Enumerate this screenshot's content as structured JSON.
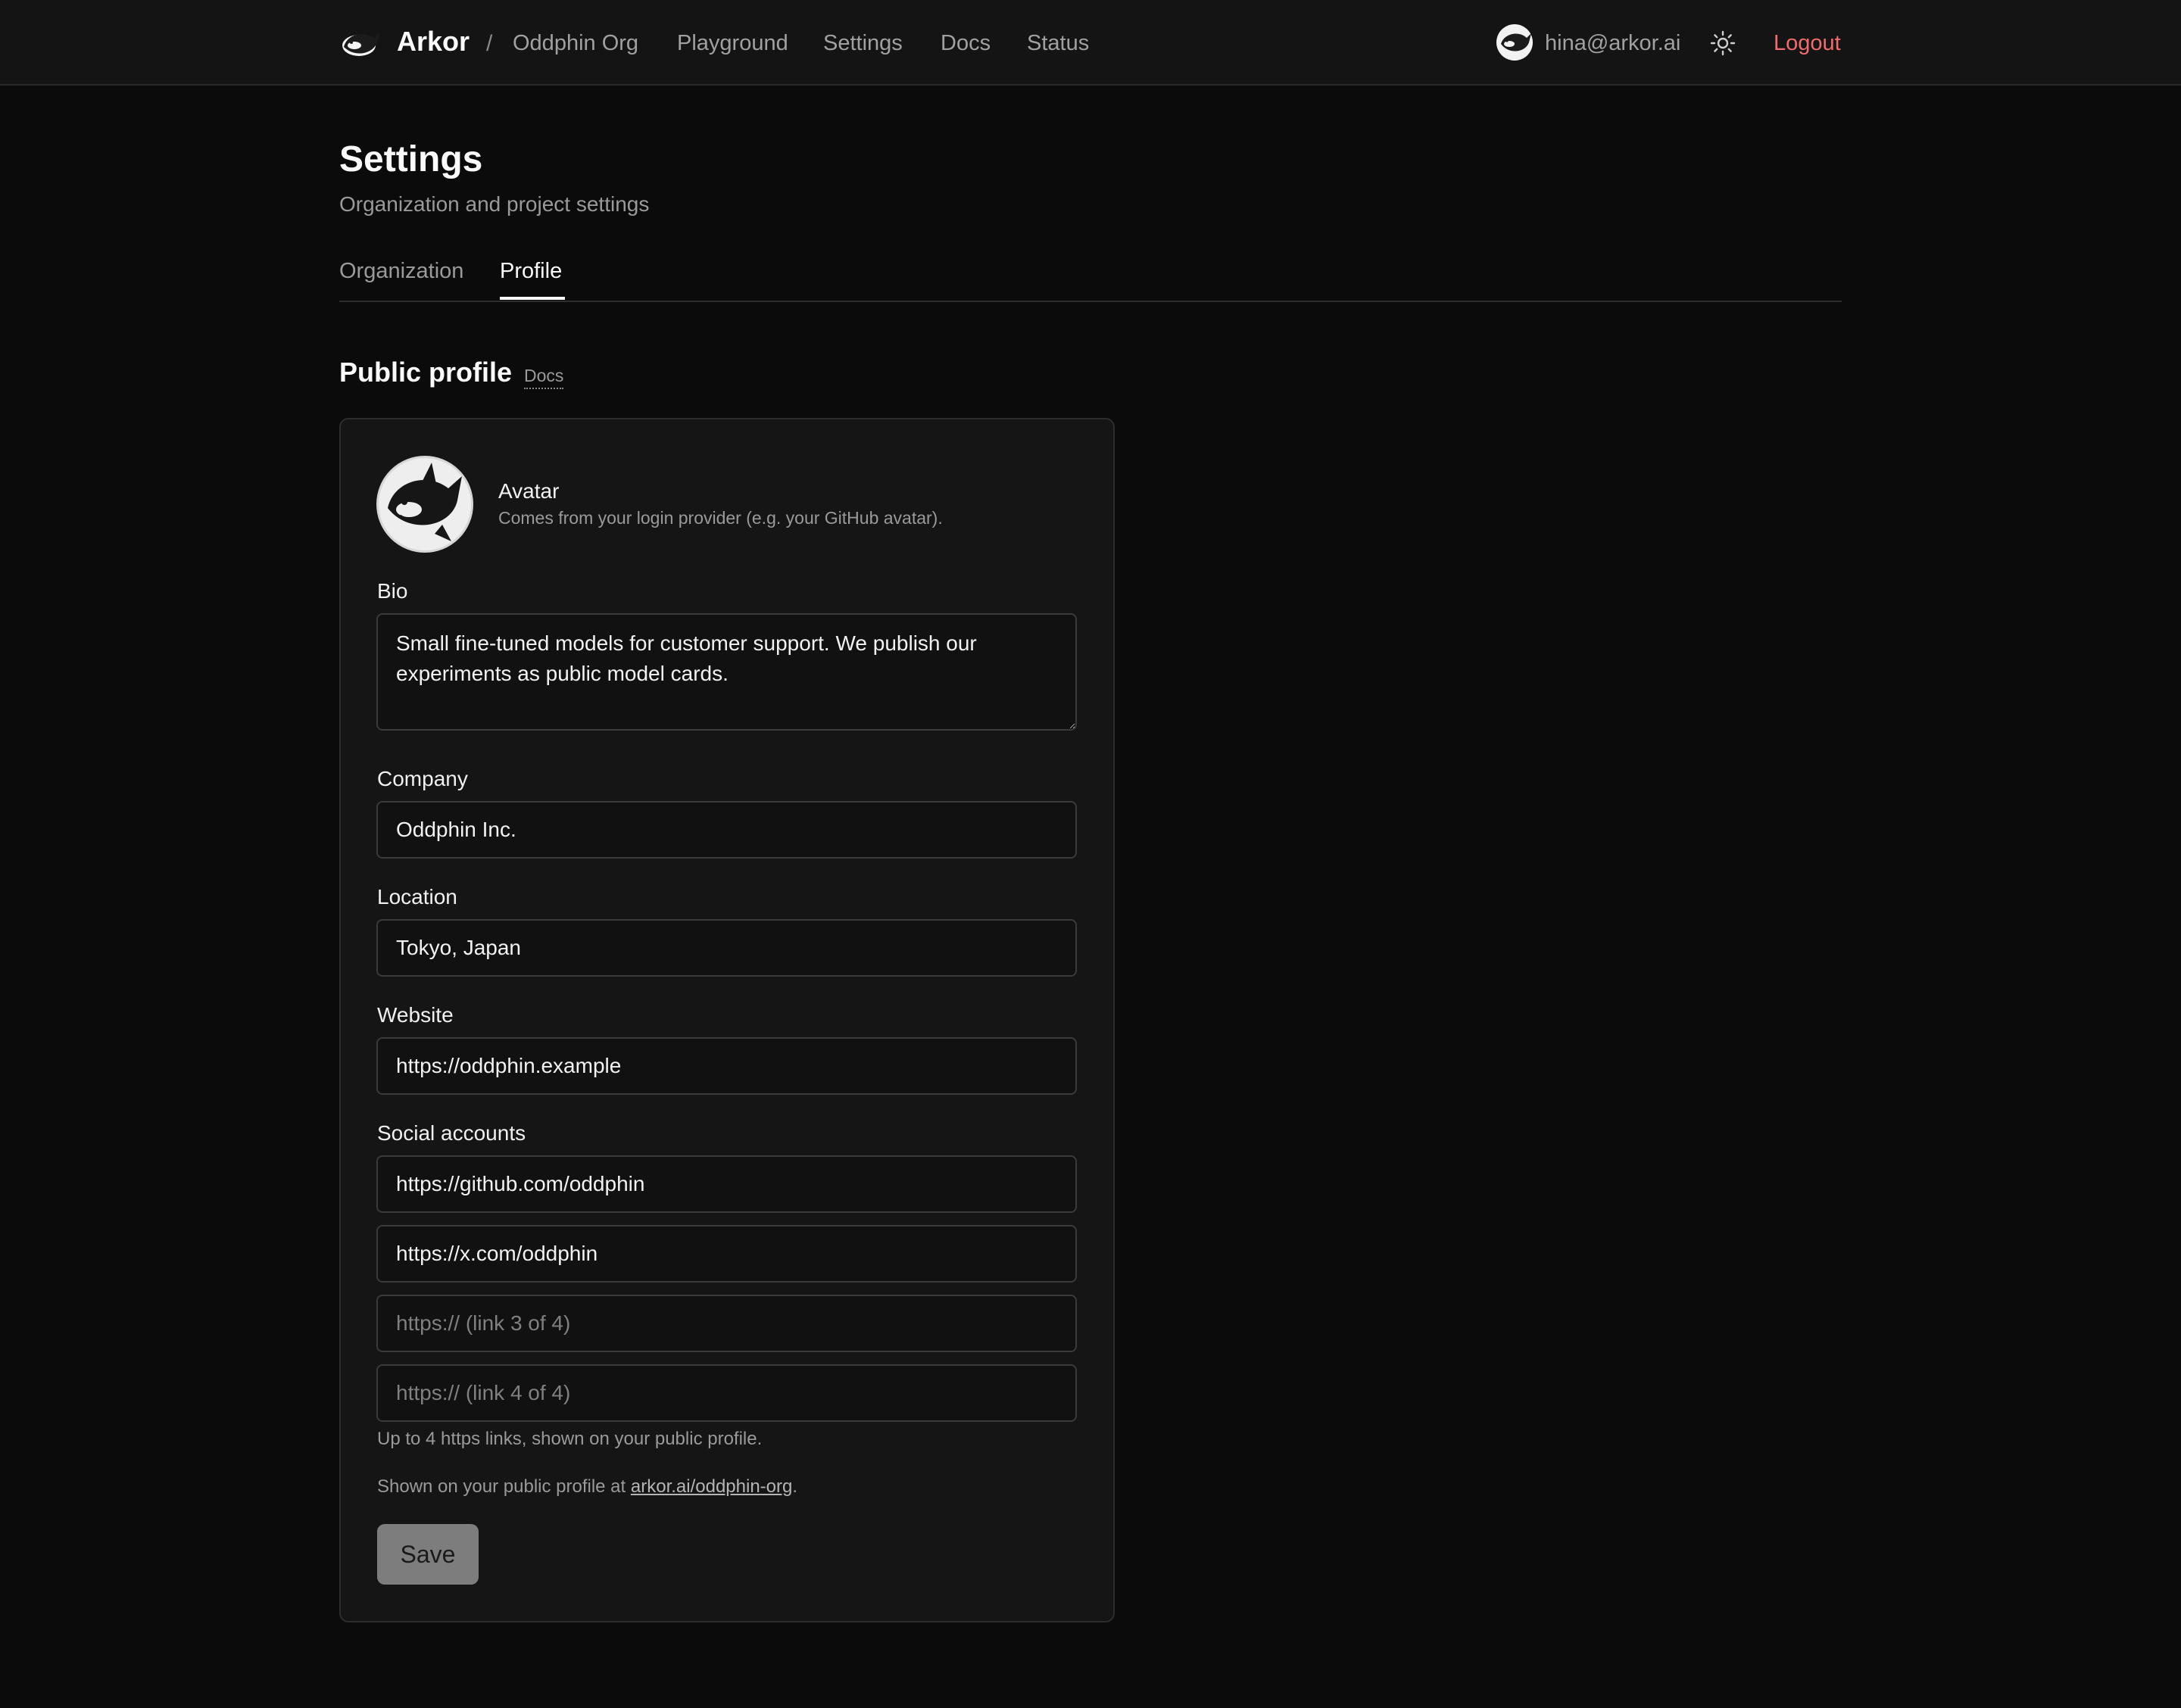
{
  "nav": {
    "brand": "Arkor",
    "separator": "/",
    "org": "Oddphin Org",
    "links": [
      "Playground",
      "Settings",
      "Docs",
      "Status"
    ],
    "user_email": "hina@arkor.ai",
    "theme_icon": "sun-icon",
    "logout": "Logout"
  },
  "page": {
    "title": "Settings",
    "subtitle": "Organization and project settings",
    "tabs": [
      {
        "label": "Organization",
        "active": false
      },
      {
        "label": "Profile",
        "active": true
      }
    ]
  },
  "section": {
    "title": "Public profile",
    "docs_link": "Docs"
  },
  "avatar": {
    "label": "Avatar",
    "help": "Comes from your login provider (e.g. your GitHub avatar)."
  },
  "form": {
    "bio_label": "Bio",
    "bio_value": "Small fine-tuned models for customer support. We publish our experiments as public model cards.",
    "company_label": "Company",
    "company_value": "Oddphin Inc.",
    "location_label": "Location",
    "location_value": "Tokyo, Japan",
    "website_label": "Website",
    "website_value": "https://oddphin.example",
    "social_label": "Social accounts",
    "social_values": [
      "https://github.com/oddphin",
      "https://x.com/oddphin",
      "",
      ""
    ],
    "social_placeholders": [
      "",
      "",
      "https:// (link 3 of 4)",
      "https:// (link 4 of 4)"
    ],
    "social_help": "Up to 4 https links, shown on your public profile.",
    "public_note_prefix": "Shown on your public profile at ",
    "public_note_link": "arkor.ai/oddphin-org",
    "public_note_suffix": ".",
    "save_label": "Save"
  },
  "colors": {
    "background": "#0b0b0b",
    "card": "#151515",
    "logout": "#f06b6b",
    "save_button": "#7d7d7d"
  }
}
